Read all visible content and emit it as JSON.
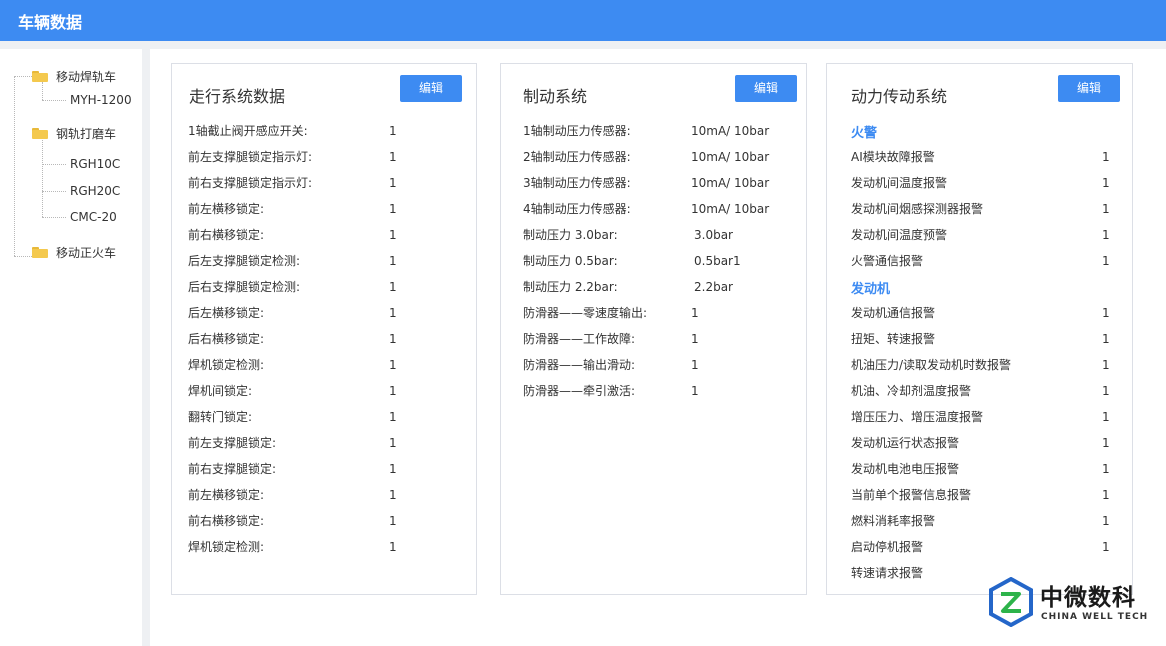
{
  "header": {
    "title": "车辆数据"
  },
  "sidebar": {
    "groups": [
      {
        "label": "移动焊轨车",
        "children": [
          "MYH-1200"
        ]
      },
      {
        "label": "钢轨打磨车",
        "children": [
          "RGH10C",
          "RGH20C",
          "CMC-20"
        ]
      },
      {
        "label": "移动正火车",
        "children": []
      }
    ]
  },
  "panels": [
    {
      "title": "走行系统数据",
      "edit_label": "编辑",
      "rows": [
        {
          "label": "1轴截止阀开感应开关:",
          "value": "1"
        },
        {
          "label": "前左支撑腿锁定指示灯:",
          "value": "1"
        },
        {
          "label": "前右支撑腿锁定指示灯:",
          "value": "1"
        },
        {
          "label": "前左横移锁定:",
          "value": "1"
        },
        {
          "label": "前右横移锁定:",
          "value": "1"
        },
        {
          "label": "后左支撑腿锁定检测:",
          "value": "1"
        },
        {
          "label": "后右支撑腿锁定检测:",
          "value": "1"
        },
        {
          "label": "后左横移锁定:",
          "value": "1"
        },
        {
          "label": "后右横移锁定:",
          "value": "1"
        },
        {
          "label": "焊机锁定检测:",
          "value": "1"
        },
        {
          "label": "焊机间锁定:",
          "value": "1"
        },
        {
          "label": "翻转门锁定:",
          "value": "1"
        },
        {
          "label": "前左支撑腿锁定:",
          "value": "1"
        },
        {
          "label": "前右支撑腿锁定:",
          "value": "1"
        },
        {
          "label": "前左横移锁定:",
          "value": "1"
        },
        {
          "label": "前右横移锁定:",
          "value": "1"
        },
        {
          "label": "焊机锁定检测:",
          "value": "1"
        }
      ]
    },
    {
      "title": "制动系统",
      "edit_label": "编辑",
      "rows": [
        {
          "label": "1轴制动压力传感器:",
          "value": "10mA/ 10bar"
        },
        {
          "label": "2轴制动压力传感器:",
          "value": "10mA/ 10bar"
        },
        {
          "label": "3轴制动压力传感器:",
          "value": "10mA/ 10bar"
        },
        {
          "label": "4轴制动压力传感器:",
          "value": "10mA/ 10bar"
        },
        {
          "label": "制动压力 3.0bar:",
          "value": "3.0bar"
        },
        {
          "label": "制动压力 0.5bar:",
          "value": "0.5bar1"
        },
        {
          "label": "制动压力 2.2bar:",
          "value": "2.2bar"
        },
        {
          "label": "防滑器——零速度输出:",
          "value": "1"
        },
        {
          "label": "防滑器——工作故障:",
          "value": "1"
        },
        {
          "label": "防滑器——输出滑动:",
          "value": "1"
        },
        {
          "label": "防滑器——牵引激活:",
          "value": "1"
        }
      ]
    },
    {
      "title": "动力传动系统",
      "edit_label": "编辑",
      "sections": [
        {
          "heading": "火警",
          "rows": [
            {
              "label": "AI模块故障报警",
              "value": "1"
            },
            {
              "label": "发动机间温度报警",
              "value": "1"
            },
            {
              "label": "发动机间烟感探测器报警",
              "value": "1"
            },
            {
              "label": "发动机间温度预警",
              "value": "1"
            },
            {
              "label": "火警通信报警",
              "value": "1"
            }
          ]
        },
        {
          "heading": "发动机",
          "rows": [
            {
              "label": "发动机通信报警",
              "value": "1"
            },
            {
              "label": "扭矩、转速报警",
              "value": "1"
            },
            {
              "label": "机油压力/读取发动机时数报警",
              "value": "1"
            },
            {
              "label": "机油、冷却剂温度报警",
              "value": "1"
            },
            {
              "label": "增压压力、增压温度报警",
              "value": "1"
            },
            {
              "label": "发动机运行状态报警",
              "value": "1"
            },
            {
              "label": "发动机电池电压报警",
              "value": "1"
            },
            {
              "label": "当前单个报警信息报警",
              "value": "1"
            },
            {
              "label": "燃料消耗率报警",
              "value": "1"
            },
            {
              "label": "启动停机报警",
              "value": "1"
            },
            {
              "label": "转速请求报警",
              "value": ""
            }
          ]
        }
      ]
    }
  ],
  "watermark": {
    "name_cn": "中微数科",
    "name_en": "CHINA WELL TECH",
    "colors": {
      "green": "#2db34a",
      "blue": "#2466c9"
    }
  }
}
